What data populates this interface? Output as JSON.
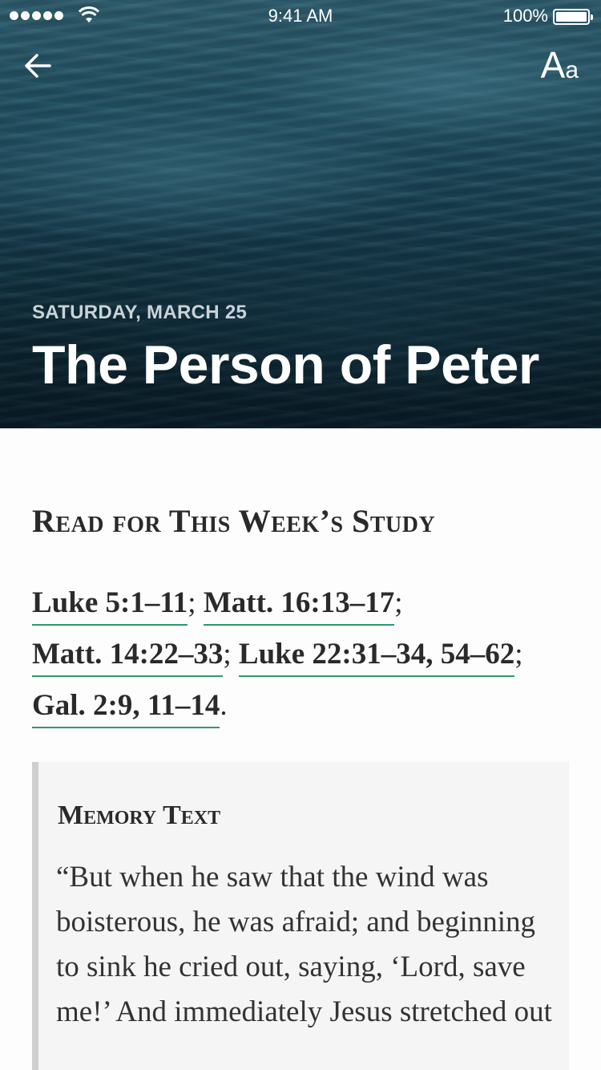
{
  "status_bar": {
    "time": "9:41 AM",
    "battery": "100%"
  },
  "header": {
    "back_icon": "arrow-left-icon",
    "font_button": {
      "big": "A",
      "small": "a"
    }
  },
  "hero": {
    "date": "SATURDAY, MARCH 25",
    "title": "The Person of Peter"
  },
  "study": {
    "heading": "Read for This Week’s Study",
    "references": [
      {
        "label": "Luke 5:1–11",
        "sep": "; "
      },
      {
        "label": "Matt. 16:13–17",
        "sep": ";"
      },
      {
        "label": "Matt. 14:22–33",
        "sep": "; "
      },
      {
        "label": "Luke 22:31–34, 54–62",
        "sep": ";"
      },
      {
        "label": "Gal. 2:9, 11–14",
        "sep": "."
      }
    ]
  },
  "memory": {
    "heading": "Memory Text",
    "text": "“But when he saw that the wind was boisterous, he was afraid; and beginning to sink he cried out, saying, ‘Lord, save me!’ And immediately Jesus stretched out"
  },
  "colors": {
    "link_underline": "#2f9a6e",
    "hero_water": "#14394a"
  }
}
